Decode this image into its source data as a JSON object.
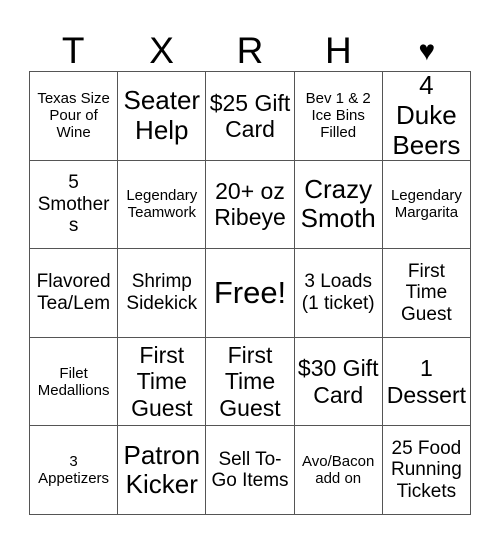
{
  "card": {
    "header_letters": [
      {
        "label": "T",
        "icon": false
      },
      {
        "label": "X",
        "icon": false
      },
      {
        "label": "R",
        "icon": false
      },
      {
        "label": "H",
        "icon": false
      },
      {
        "label": "♥",
        "icon": true,
        "icon_name": "heart-icon"
      }
    ],
    "columns": 5,
    "rows": 5,
    "colors": {
      "background": "#ffffff",
      "text": "#000000",
      "grid_line": "#555555"
    },
    "squares": [
      {
        "text": "Texas Size Pour of Wine",
        "size": "sm",
        "free": false
      },
      {
        "text": "Seater Help",
        "size": "xl",
        "free": false
      },
      {
        "text": "$25 Gift Card",
        "size": "lg",
        "free": false
      },
      {
        "text": "Bev 1 & 2 Ice Bins Filled",
        "size": "sm",
        "free": false
      },
      {
        "text": "4 Duke Beers",
        "size": "xl",
        "free": false
      },
      {
        "text": "5 Smothers",
        "size": "md",
        "free": false
      },
      {
        "text": "Legendary Teamwork",
        "size": "sm",
        "free": false
      },
      {
        "text": "20+ oz Ribeye",
        "size": "lg",
        "free": false
      },
      {
        "text": "Crazy Smoth",
        "size": "xl",
        "free": false
      },
      {
        "text": "Legendary Margarita",
        "size": "sm",
        "free": false
      },
      {
        "text": "Flavored Tea/Lem",
        "size": "md",
        "free": false
      },
      {
        "text": "Shrimp Sidekick",
        "size": "md",
        "free": false
      },
      {
        "text": "Free!",
        "size": "free",
        "free": true
      },
      {
        "text": "3 Loads (1 ticket)",
        "size": "md",
        "free": false
      },
      {
        "text": "First Time Guest",
        "size": "md",
        "free": false
      },
      {
        "text": "Filet Medallions",
        "size": "sm",
        "free": false
      },
      {
        "text": "First Time Guest",
        "size": "lg",
        "free": false
      },
      {
        "text": "First Time Guest",
        "size": "lg",
        "free": false
      },
      {
        "text": "$30 Gift Card",
        "size": "lg",
        "free": false
      },
      {
        "text": "1 Dessert",
        "size": "lg",
        "free": false
      },
      {
        "text": "3 Appetizers",
        "size": "sm",
        "free": false
      },
      {
        "text": "Patron Kicker",
        "size": "xl",
        "free": false
      },
      {
        "text": "Sell To-Go Items",
        "size": "md",
        "free": false
      },
      {
        "text": "Avo/Bacon add on",
        "size": "sm",
        "free": false
      },
      {
        "text": "25 Food Running Tickets",
        "size": "md",
        "free": false
      }
    ]
  }
}
